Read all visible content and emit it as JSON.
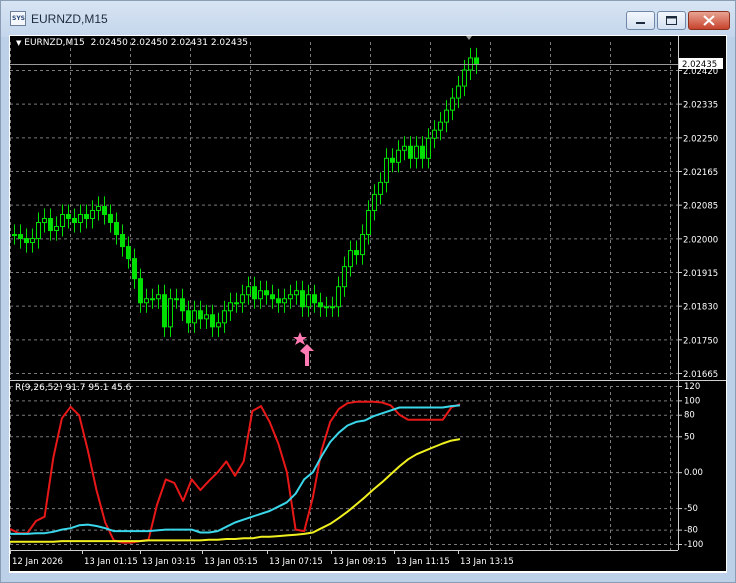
{
  "window": {
    "title": "EURNZD,M15"
  },
  "chart": {
    "header_symbol": "EURNZD,M15",
    "header_ohlc": "2.02450 2.02450 2.02431 2.02435",
    "current_price": "2.02435",
    "colors": {
      "background": "#000000",
      "grid": "#7a7a7a",
      "candle": "#00e000",
      "price_label_bg": "#ffffff",
      "signal": "#ff7ab3",
      "rsi_red": "#e81818",
      "rsi_cyan": "#3ad6ea",
      "rsi_yellow": "#f0f020"
    }
  },
  "indicator": {
    "header": "R(9,26,52) 91.7 95.1 45.6"
  },
  "chart_data": {
    "type": "candlestick",
    "price_axis_ticks": [
      "2.02420",
      "2.02335",
      "2.02250",
      "2.02165",
      "2.02085",
      "2.02000",
      "2.01915",
      "2.01830",
      "2.01750",
      "2.01665"
    ],
    "indicator_axis_ticks": [
      "120",
      "100",
      "80",
      "50",
      "0.00",
      "-50",
      "-80",
      "-100"
    ],
    "time_axis_labels": [
      "12 Jan 2026",
      "13 Jan 01:15",
      "13 Jan 03:15",
      "13 Jan 05:15",
      "13 Jan 07:15",
      "13 Jan 09:15",
      "13 Jan 11:15",
      "13 Jan 13:15"
    ],
    "series": [
      {
        "color": "#e81818",
        "values": [
          -79,
          -85,
          -85,
          -68,
          -62,
          20,
          75,
          91,
          79,
          30,
          -25,
          -70,
          -95,
          -98,
          -98,
          -96,
          -94,
          -45,
          -10,
          -15,
          -40,
          -10,
          -25,
          -12,
          0,
          15,
          -5,
          15,
          85,
          92,
          70,
          40,
          0,
          -80,
          -82,
          -35,
          30,
          70,
          88,
          96,
          98,
          98,
          98,
          97,
          93,
          80,
          73,
          73,
          73,
          73,
          73,
          90,
          95
        ]
      },
      {
        "color": "#3ad6ea",
        "values": [
          -86,
          -86,
          -86,
          -85,
          -85,
          -83,
          -80,
          -78,
          -74,
          -73,
          -75,
          -78,
          -82,
          -82,
          -82,
          -82,
          -82,
          -81,
          -80,
          -80,
          -80,
          -80,
          -84,
          -84,
          -82,
          -76,
          -70,
          -66,
          -62,
          -58,
          -54,
          -48,
          -42,
          -30,
          -10,
          0,
          22,
          42,
          55,
          65,
          70,
          72,
          78,
          82,
          86,
          90,
          90,
          90,
          90,
          90,
          90,
          92,
          93
        ]
      },
      {
        "color": "#f0f020",
        "values": [
          -97,
          -97,
          -97,
          -97,
          -97,
          -97,
          -96,
          -96,
          -96,
          -96,
          -96,
          -96,
          -96,
          -96,
          -96,
          -96,
          -95,
          -95,
          -95,
          -95,
          -95,
          -95,
          -95,
          -94,
          -94,
          -93,
          -93,
          -92,
          -92,
          -90,
          -90,
          -89,
          -88,
          -87,
          -86,
          -84,
          -78,
          -72,
          -64,
          -55,
          -45,
          -35,
          -24,
          -14,
          -3,
          8,
          18,
          25,
          30,
          35,
          40,
          44,
          46
        ]
      }
    ]
  }
}
